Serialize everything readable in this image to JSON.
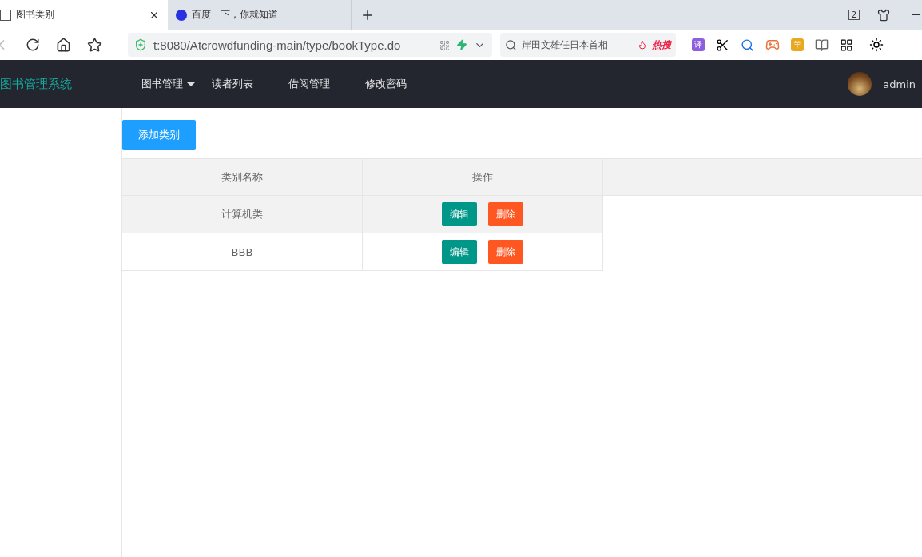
{
  "browser": {
    "tabs": [
      {
        "title": "图书类别",
        "selected": true
      },
      {
        "title": "百度一下，你就知道",
        "selected": false
      }
    ],
    "window_count": "2",
    "address": "t:8080/Atcrowdfunding-main/type/bookType.do",
    "search": {
      "value": "岸田文雄任日本首相",
      "badge": "热搜"
    },
    "extensions": [
      {
        "kind": "translate",
        "label": "译"
      },
      {
        "kind": "scissors"
      },
      {
        "kind": "magnifier"
      },
      {
        "kind": "gamepad"
      },
      {
        "kind": "shield",
        "label": "羊"
      },
      {
        "kind": "book"
      },
      {
        "kind": "grid"
      }
    ]
  },
  "app": {
    "brand": "图书管理系统",
    "nav": [
      {
        "label": "图书管理",
        "dropdown": true
      },
      {
        "label": "读者列表",
        "dropdown": false
      },
      {
        "label": "借阅管理",
        "dropdown": false
      },
      {
        "label": "修改密码",
        "dropdown": false
      }
    ],
    "user": "admin",
    "add_button": "添加类别",
    "table": {
      "columns": [
        "类别名称",
        "操作"
      ],
      "rows": [
        {
          "name": "计算机类",
          "highlighted": true,
          "actions": [
            "编辑",
            "删除"
          ]
        },
        {
          "name": "BBB",
          "highlighted": false,
          "actions": [
            "编辑",
            "删除"
          ]
        }
      ]
    }
  }
}
